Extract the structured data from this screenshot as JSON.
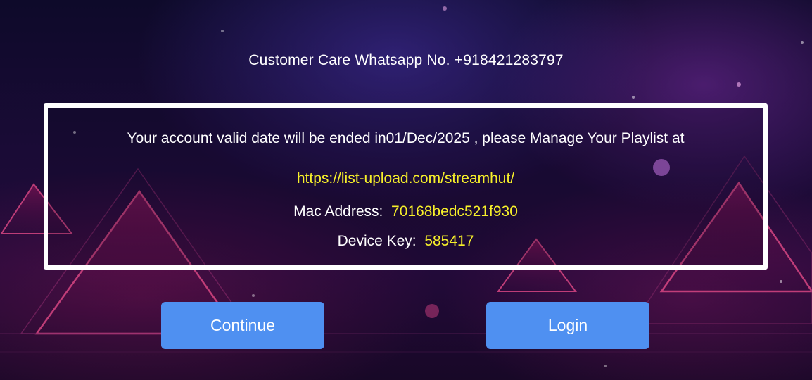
{
  "header": {
    "customer_care": "Customer Care Whatsapp No. +918421283797"
  },
  "notice": {
    "message": "Your account valid date will be ended in01/Dec/2025 , please Manage Your Playlist at",
    "playlist_url": "https://list-upload.com/streamhut/",
    "mac_label": "Mac Address:",
    "mac_value": "70168bedc521f930",
    "device_key_label": "Device Key:",
    "device_key_value": "585417"
  },
  "actions": {
    "continue_label": "Continue",
    "login_label": "Login"
  },
  "colors": {
    "accent_button": "#4f90f1",
    "highlight_text": "#f7f02a",
    "panel_border": "#ffffff"
  }
}
